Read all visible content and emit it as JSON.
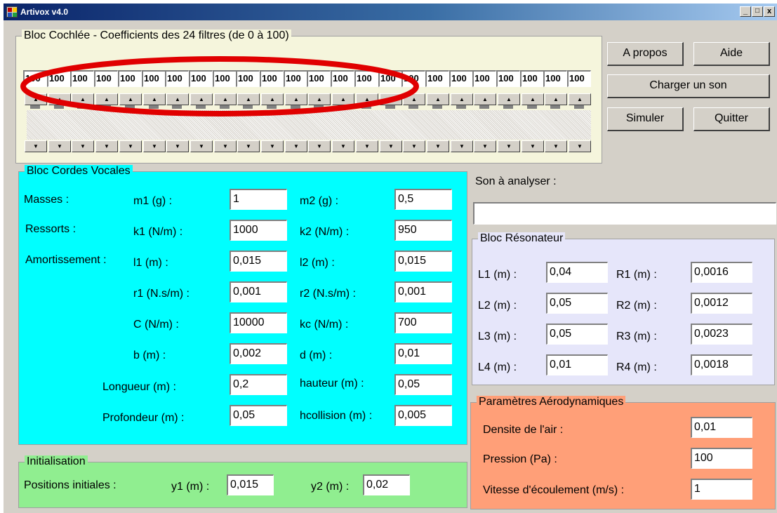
{
  "window": {
    "title": "Artivox v4.0",
    "controls": {
      "minimize": "_",
      "maximize": "□",
      "close": "x"
    }
  },
  "cochlea": {
    "title": "Bloc Cochlée - Coefficients des 24 filtres (de 0 à 100)",
    "values": [
      "100",
      "100",
      "100",
      "100",
      "100",
      "100",
      "100",
      "100",
      "100",
      "100",
      "100",
      "100",
      "100",
      "100",
      "100",
      "100",
      "100",
      "100",
      "100",
      "100",
      "100",
      "100",
      "100",
      "100"
    ],
    "up_arrow": "▲",
    "down_arrow": "▼"
  },
  "buttons": {
    "about": "A propos",
    "help": "Aide",
    "load_sound": "Charger un son",
    "simulate": "Simuler",
    "quit": "Quitter"
  },
  "vocal": {
    "title": "Bloc Cordes Vocales",
    "masses_label": "Masses :",
    "springs_label": "Ressorts :",
    "damping_label": "Amortissement :",
    "m1_label": "m1 (g) :",
    "m1": "1",
    "m2_label": "m2 (g) :",
    "m2": "0,5",
    "k1_label": "k1 (N/m) :",
    "k1": "1000",
    "k2_label": "k2 (N/m) :",
    "k2": "950",
    "l1_label": "l1 (m) :",
    "l1": "0,015",
    "l2_label": "l2 (m) :",
    "l2": "0,015",
    "r1_label": "r1 (N.s/m) :",
    "r1": "0,001",
    "r2_label": "r2 (N.s/m) :",
    "r2": "0,001",
    "c_label": "C (N/m) :",
    "c": "10000",
    "kc_label": "kc (N/m) :",
    "kc": "700",
    "b_label": "b (m) :",
    "b": "0,002",
    "d_label": "d (m) :",
    "d": "0,01",
    "length_label": "Longueur (m) :",
    "length": "0,2",
    "height_label": "hauteur (m) :",
    "height": "0,05",
    "depth_label": "Profondeur (m) :",
    "depth": "0,05",
    "hcollision_label": "hcollision (m) :",
    "hcollision": "0,005"
  },
  "init": {
    "title": "Initialisation",
    "positions_label": "Positions initiales :",
    "y1_label": "y1 (m) :",
    "y1": "0,015",
    "y2_label": "y2 (m) :",
    "y2": "0,02"
  },
  "sound": {
    "label": "Son à analyser :",
    "value": ""
  },
  "resonator": {
    "title": "Bloc Résonateur",
    "L1_label": "L1 (m) :",
    "L1": "0,04",
    "L2_label": "L2 (m) :",
    "L2": "0,05",
    "L3_label": "L3 (m) :",
    "L3": "0,05",
    "L4_label": "L4 (m) :",
    "L4": "0,01",
    "R1_label": "R1 (m) :",
    "R1": "0,0016",
    "R2_label": "R2 (m) :",
    "R2": "0,0012",
    "R3_label": "R3 (m) :",
    "R3": "0,0023",
    "R4_label": "R4 (m) :",
    "R4": "0,0018"
  },
  "aero": {
    "title": "Paramètres Aérodynamiques",
    "density_label": "Densite de l'air :",
    "density": "0,01",
    "pressure_label": "Pression (Pa) :",
    "pressure": "100",
    "speed_label": "Vitesse d'écoulement (m/s) :",
    "speed": "1"
  },
  "colors": {
    "window_bg": "#d4d0c8",
    "cochlea_bg": "#f5f5dc",
    "vocal_bg": "#00ffff",
    "init_bg": "#90ee90",
    "resonator_bg": "#e6e6fa",
    "aero_bg": "#ff9f78",
    "annotation": "#e00000"
  }
}
